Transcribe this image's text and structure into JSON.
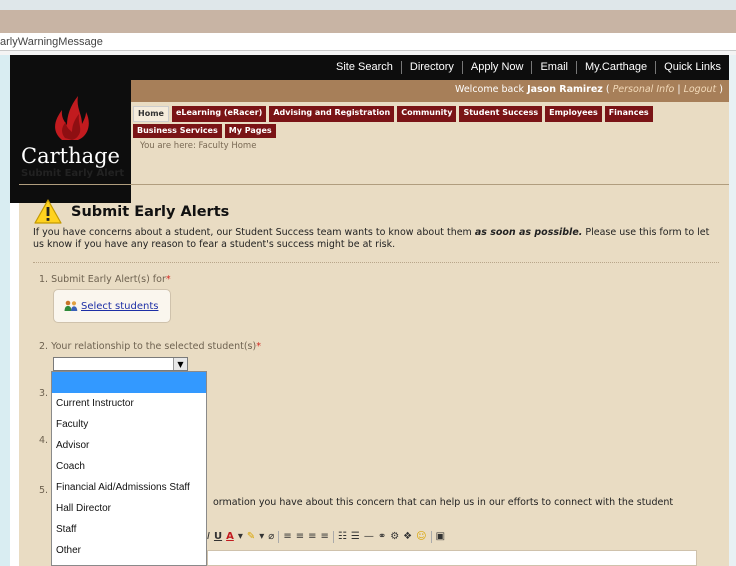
{
  "browser": {
    "address_text": "arlyWarningMessage"
  },
  "top_links": [
    "Site Search",
    "Directory",
    "Apply Now",
    "Email",
    "My.Carthage",
    "Quick Links"
  ],
  "logo": {
    "text": "Carthage"
  },
  "welcome": {
    "prefix": "Welcome back ",
    "user": "Jason Ramirez",
    "open_paren": " ( ",
    "personal_info": "Personal Info",
    "sep": " | ",
    "logout": "Logout",
    "close_paren": " )"
  },
  "nav_items": [
    {
      "label": "Home",
      "active": true
    },
    {
      "label": "eLearning (eRacer)",
      "active": false
    },
    {
      "label": "Advising and Registration",
      "active": false
    },
    {
      "label": "Community",
      "active": false
    },
    {
      "label": "Student Success",
      "active": false
    },
    {
      "label": "Employees",
      "active": false
    },
    {
      "label": "Finances",
      "active": false
    },
    {
      "label": "Business Services",
      "active": false
    },
    {
      "label": "My Pages",
      "active": false
    }
  ],
  "breadcrumb": "You are here:  Faculty Home",
  "page_head": "Submit Early Alert",
  "alert": {
    "title": "Submit Early Alerts",
    "intro_1": "If you have concerns about a student, our Student Success team wants to know about them ",
    "intro_emph": "as soon as possible.",
    "intro_2": " Please use this form to let us know if you have any reason to fear a student's success might be at risk."
  },
  "questions": {
    "q1": "1. Submit Early Alert(s) for",
    "q2": "2. Your relationship to the selected student(s)",
    "q3": "3.",
    "q4": "4.",
    "q5": "5.",
    "q5_text": "ormation you have about this concern that can help us in our efforts to connect with the student",
    "required_mark": "*"
  },
  "select_students": "Select students",
  "relationship_select": {
    "selected": "",
    "options": [
      "",
      "Current Instructor",
      "Faculty",
      "Advisor",
      "Coach",
      "Financial Aid/Admissions Staff",
      "Hall Director",
      "Staff",
      "Other"
    ]
  },
  "toolbar_glyphs": [
    "I",
    "U",
    "A",
    "▾",
    "✎",
    "▾",
    "⌀",
    "≡",
    "≡",
    "≡",
    "≡",
    "☷",
    "☰",
    "—",
    "⚭",
    "⚙",
    "❖",
    "☺",
    "▣"
  ],
  "colors": {
    "nav_red": "#7a1416",
    "header_brown": "#a77f59",
    "page_bg": "#e9dcc3",
    "link_blue": "#1d2fa6",
    "highlight": "#3399ff"
  }
}
